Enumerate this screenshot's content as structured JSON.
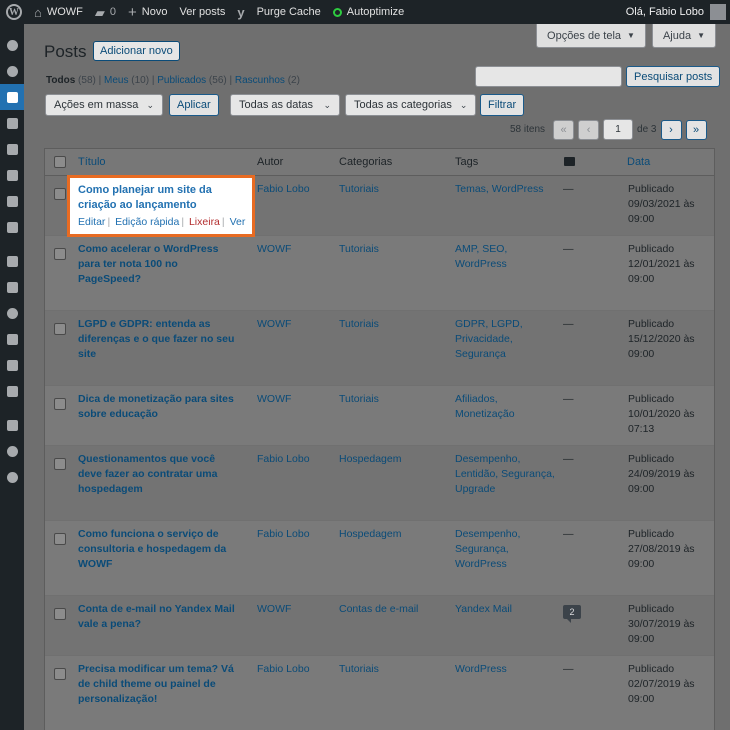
{
  "adminbar": {
    "site_name": "WOWF",
    "comments_count": "0",
    "new_label": "Novo",
    "view_posts": "Ver posts",
    "purge_cache": "Purge Cache",
    "autoptimize": "Autoptimize",
    "greeting": "Olá, Fabio Lobo"
  },
  "screen_options": {
    "options_label": "Opções de tela",
    "help_label": "Ajuda"
  },
  "page": {
    "title": "Posts",
    "add_new": "Adicionar novo"
  },
  "views": {
    "all_label": "Todos",
    "all_count": "(58)",
    "mine_label": "Meus",
    "mine_count": "(10)",
    "published_label": "Publicados",
    "published_count": "(56)",
    "drafts_label": "Rascunhos",
    "drafts_count": "(2)"
  },
  "search": {
    "button": "Pesquisar posts",
    "value": ""
  },
  "filters": {
    "bulk_action": "Ações em massa",
    "apply": "Aplicar",
    "dates": "Todas as datas",
    "categories": "Todas as categorias",
    "filter": "Filtrar"
  },
  "pagination": {
    "items": "58 itens",
    "current_page": "1",
    "of_label": "de 3",
    "first": "«",
    "prev": "‹",
    "next": "›",
    "last": "»"
  },
  "table": {
    "headers": {
      "title": "Título",
      "author": "Autor",
      "categories": "Categorias",
      "tags": "Tags",
      "date": "Data"
    },
    "row_actions": {
      "edit": "Editar",
      "quick_edit": "Edição rápida",
      "trash": "Lixeira",
      "view": "Ver"
    },
    "rows": [
      {
        "title_1": "Como planejar um site da",
        "title_2": "criação ao lançamento",
        "author": "Fabio Lobo",
        "category": "Tutoriais",
        "tags_1": "Temas, WordPress",
        "tags_2": "",
        "tags_3": "",
        "comments": "—",
        "status": "Publicado",
        "date": "09/03/2021 às",
        "time": "09:00"
      },
      {
        "title_1": "Como acelerar o WordPress",
        "title_2": "para ter nota 100 no",
        "title_3": "PageSpeed?",
        "author": "WOWF",
        "category": "Tutoriais",
        "tags_1": "AMP, SEO,",
        "tags_2": "WordPress",
        "tags_3": "",
        "comments": "—",
        "status": "Publicado",
        "date": "12/01/2021 às",
        "time": "09:00"
      },
      {
        "title_1": "LGPD e GDPR: entenda as",
        "title_2": "diferenças e o que fazer no seu",
        "title_3": "site",
        "author": "WOWF",
        "category": "Tutoriais",
        "tags_1": "GDPR, LGPD,",
        "tags_2": "Privacidade,",
        "tags_3": "Segurança",
        "comments": "—",
        "status": "Publicado",
        "date": "15/12/2020 às",
        "time": "09:00"
      },
      {
        "title_1": "Dica de monetização para sites",
        "title_2": "sobre educação",
        "title_3": "",
        "author": "WOWF",
        "category": "Tutoriais",
        "tags_1": "Afiliados,",
        "tags_2": "Monetização",
        "tags_3": "",
        "comments": "—",
        "status": "Publicado",
        "date": "10/01/2020 às",
        "time": "07:13"
      },
      {
        "title_1": "Questionamentos que você",
        "title_2": "deve fazer ao contratar uma",
        "title_3": "hospedagem",
        "author": "Fabio Lobo",
        "category": "Hospedagem",
        "tags_1": "Desempenho,",
        "tags_2": "Lentidão, Segurança,",
        "tags_3": "Upgrade",
        "comments": "—",
        "status": "Publicado",
        "date": "24/09/2019 às",
        "time": "09:00"
      },
      {
        "title_1": "Como funciona o serviço de",
        "title_2": "consultoria e hospedagem da",
        "title_3": "WOWF",
        "author": "Fabio Lobo",
        "category": "Hospedagem",
        "tags_1": "Desempenho,",
        "tags_2": "Segurança,",
        "tags_3": "WordPress",
        "comments": "—",
        "status": "Publicado",
        "date": "27/08/2019 às",
        "time": "09:00"
      },
      {
        "title_1": "Conta de e-mail no Yandex Mail",
        "title_2": "vale a pena?",
        "title_3": "",
        "author": "WOWF",
        "category": "Contas de e-mail",
        "tags_1": "Yandex Mail",
        "tags_2": "",
        "tags_3": "",
        "comments": "2",
        "status": "Publicado",
        "date": "30/07/2019 às",
        "time": "09:00"
      },
      {
        "title_1": "Precisa modificar um tema? Vá",
        "title_2": "de child theme ou painel de",
        "title_3": "personalização!",
        "author": "Fabio Lobo",
        "category": "Tutoriais",
        "tags_1": "WordPress",
        "tags_2": "",
        "tags_3": "",
        "comments": "—",
        "status": "Publicado",
        "date": "02/07/2019 às",
        "time": "09:00"
      }
    ]
  }
}
